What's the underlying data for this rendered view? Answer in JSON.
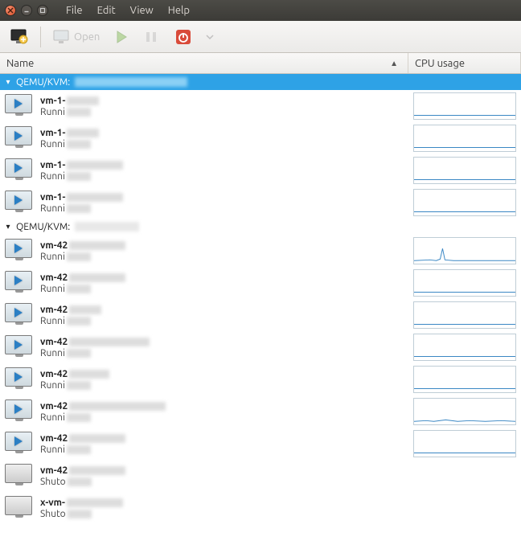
{
  "menubar": [
    "File",
    "Edit",
    "View",
    "Help"
  ],
  "toolbar": {
    "open_label": "Open"
  },
  "columns": {
    "name": "Name",
    "cpu": "CPU usage"
  },
  "groups": [
    {
      "expanded": true,
      "selected": true,
      "label": "QEMU/KVM:",
      "blur_width": 140,
      "vms": [
        {
          "name": "vm-1-",
          "state": "Runni",
          "running": true,
          "blur_name_w": 40,
          "blur_state_w": 30,
          "cpu_spark": "flat"
        },
        {
          "name": "vm-1-",
          "state": "Runni",
          "running": true,
          "blur_name_w": 40,
          "blur_state_w": 30,
          "cpu_spark": "flat"
        },
        {
          "name": "vm-1-",
          "state": "Runni",
          "running": true,
          "blur_name_w": 70,
          "blur_state_w": 30,
          "cpu_spark": "flat"
        },
        {
          "name": "vm-1-",
          "state": "Runni",
          "running": true,
          "blur_name_w": 70,
          "blur_state_w": 30,
          "cpu_spark": "flat"
        }
      ]
    },
    {
      "expanded": true,
      "selected": false,
      "label": "QEMU/KVM:",
      "blur_width": 80,
      "vms": [
        {
          "name": "vm-42",
          "state": "Runni",
          "running": true,
          "blur_name_w": 70,
          "blur_state_w": 30,
          "cpu_spark": "spike"
        },
        {
          "name": "vm-42",
          "state": "Runni",
          "running": true,
          "blur_name_w": 70,
          "blur_state_w": 30,
          "cpu_spark": "flat"
        },
        {
          "name": "vm-42",
          "state": "Runni",
          "running": true,
          "blur_name_w": 40,
          "blur_state_w": 30,
          "cpu_spark": "flat"
        },
        {
          "name": "vm-42",
          "state": "Runni",
          "running": true,
          "blur_name_w": 100,
          "blur_state_w": 30,
          "cpu_spark": "flat"
        },
        {
          "name": "vm-42",
          "state": "Runni",
          "running": true,
          "blur_name_w": 50,
          "blur_state_w": 30,
          "cpu_spark": "flat"
        },
        {
          "name": "vm-42",
          "state": "Runni",
          "running": true,
          "blur_name_w": 120,
          "blur_state_w": 30,
          "cpu_spark": "wavy"
        },
        {
          "name": "vm-42",
          "state": "Runni",
          "running": true,
          "blur_name_w": 70,
          "blur_state_w": 30,
          "cpu_spark": "flat"
        },
        {
          "name": "vm-42",
          "state": "Shuto",
          "running": false,
          "blur_name_w": 70,
          "blur_state_w": 30,
          "cpu_spark": "none"
        },
        {
          "name": "x-vm-",
          "state": "Shuto",
          "running": false,
          "blur_name_w": 70,
          "blur_state_w": 30,
          "cpu_spark": "none"
        }
      ]
    }
  ]
}
